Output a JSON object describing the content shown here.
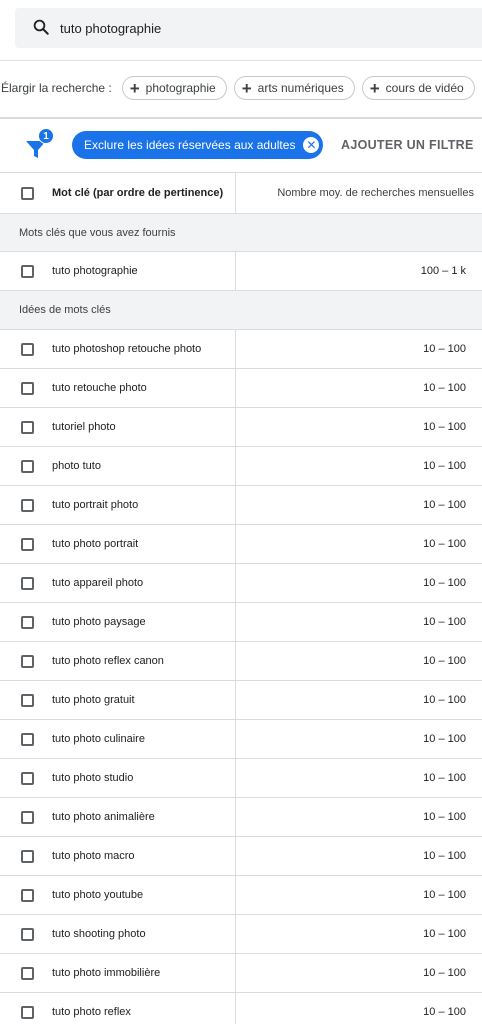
{
  "search": {
    "query": "tuto photographie"
  },
  "broaden": {
    "label": "Élargir la recherche :",
    "chips": [
      {
        "label": "photographie"
      },
      {
        "label": "arts numériques"
      },
      {
        "label": "cours de vidéo"
      }
    ]
  },
  "filters": {
    "badge_count": "1",
    "active_filter": "Exclure les idées réservées aux adultes",
    "add_filter_label": "AJOUTER UN FILTRE"
  },
  "table": {
    "columns": [
      "Mot clé (par ordre de pertinence)",
      "Nombre moy. de recherches mensuelles"
    ],
    "section_provided": "Mots clés que vous avez fournis",
    "provided_rows": [
      {
        "keyword": "tuto photographie",
        "volume": "100 – 1 k"
      }
    ],
    "section_ideas": "Idées de mots clés",
    "idea_rows": [
      {
        "keyword": "tuto photoshop retouche photo",
        "volume": "10 – 100"
      },
      {
        "keyword": "tuto retouche photo",
        "volume": "10 – 100"
      },
      {
        "keyword": "tutoriel photo",
        "volume": "10 – 100"
      },
      {
        "keyword": "photo tuto",
        "volume": "10 – 100"
      },
      {
        "keyword": "tuto portrait photo",
        "volume": "10 – 100"
      },
      {
        "keyword": "tuto photo portrait",
        "volume": "10 – 100"
      },
      {
        "keyword": "tuto appareil photo",
        "volume": "10 – 100"
      },
      {
        "keyword": "tuto photo paysage",
        "volume": "10 – 100"
      },
      {
        "keyword": "tuto photo reflex canon",
        "volume": "10 – 100"
      },
      {
        "keyword": "tuto photo gratuit",
        "volume": "10 – 100"
      },
      {
        "keyword": "tuto photo culinaire",
        "volume": "10 – 100"
      },
      {
        "keyword": "tuto photo studio",
        "volume": "10 – 100"
      },
      {
        "keyword": "tuto photo animalière",
        "volume": "10 – 100"
      },
      {
        "keyword": "tuto photo macro",
        "volume": "10 – 100"
      },
      {
        "keyword": "tuto photo youtube",
        "volume": "10 – 100"
      },
      {
        "keyword": "tuto shooting photo",
        "volume": "10 – 100"
      },
      {
        "keyword": "tuto photo immobilière",
        "volume": "10 – 100"
      },
      {
        "keyword": "tuto photo reflex",
        "volume": "10 – 100"
      }
    ]
  },
  "colors": {
    "accent": "#1a73e8",
    "section_bg": "#f1f3f4",
    "divider": "#dadce0"
  }
}
